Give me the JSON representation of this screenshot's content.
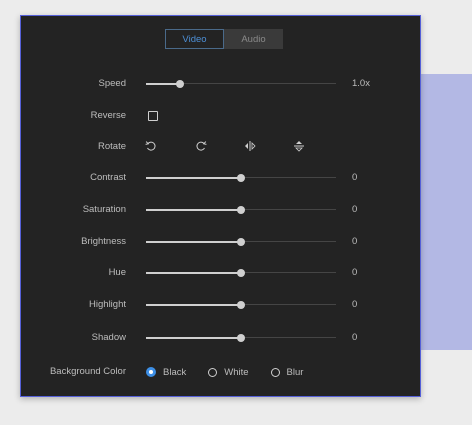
{
  "tabs": [
    {
      "label": "Video",
      "active": true
    },
    {
      "label": "Audio",
      "active": false
    }
  ],
  "speed": {
    "label": "Speed",
    "value": "1.0x",
    "level": 0.18
  },
  "reverse": {
    "label": "Reverse",
    "checked": false
  },
  "rotate": {
    "label": "Rotate",
    "icons": [
      "rotate-left-icon",
      "rotate-right-icon",
      "flip-horizontal-icon",
      "flip-vertical-icon"
    ]
  },
  "sliders": [
    {
      "key": "contrast",
      "label": "Contrast",
      "value": "0",
      "level": 0.5
    },
    {
      "key": "saturation",
      "label": "Saturation",
      "value": "0",
      "level": 0.5
    },
    {
      "key": "brightness",
      "label": "Brightness",
      "value": "0",
      "level": 0.5
    },
    {
      "key": "hue",
      "label": "Hue",
      "value": "0",
      "level": 0.5
    },
    {
      "key": "highlight",
      "label": "Highlight",
      "value": "0",
      "level": 0.5
    },
    {
      "key": "shadow",
      "label": "Shadow",
      "value": "0",
      "level": 0.5
    }
  ],
  "background_color": {
    "label": "Background Color",
    "options": [
      "Black",
      "White",
      "Blur"
    ],
    "selected": "Black"
  },
  "colors": {
    "panel": "#232323",
    "border": "#5560d8",
    "accent_blue": "#3d8fe6",
    "side_accent": "#b3b8e4"
  }
}
